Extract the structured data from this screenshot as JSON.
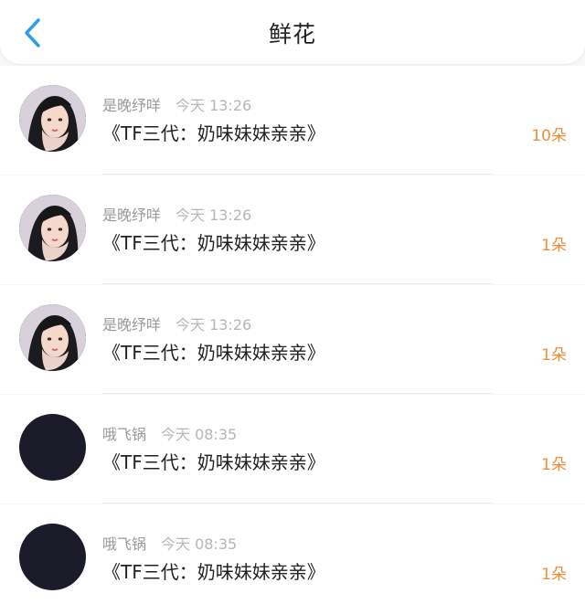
{
  "header": {
    "title": "鲜花",
    "back_icon": "chevron-left-icon",
    "accent_color": "#2f9ee8"
  },
  "list": [
    {
      "name": "是晚纾咩",
      "time": "今天 13:26",
      "work": "《TF三代：奶味妹妹亲亲》",
      "count": "10朵",
      "avatar": "girl-photo"
    },
    {
      "name": "是晚纾咩",
      "time": "今天 13:26",
      "work": "《TF三代：奶味妹妹亲亲》",
      "count": "1朵",
      "avatar": "girl-photo"
    },
    {
      "name": "是晚纾咩",
      "time": "今天 13:26",
      "work": "《TF三代：奶味妹妹亲亲》",
      "count": "1朵",
      "avatar": "girl-photo"
    },
    {
      "name": "哦飞锅",
      "time": "今天 08:35",
      "work": "《TF三代：奶味妹妹亲亲》",
      "count": "1朵",
      "avatar": "dark-circle"
    },
    {
      "name": "哦飞锅",
      "time": "今天 08:35",
      "work": "《TF三代：奶味妹妹亲亲》",
      "count": "1朵",
      "avatar": "dark-circle"
    }
  ],
  "colors": {
    "count": "#f28d3a",
    "name": "#999999",
    "time": "#b6b6b6"
  }
}
